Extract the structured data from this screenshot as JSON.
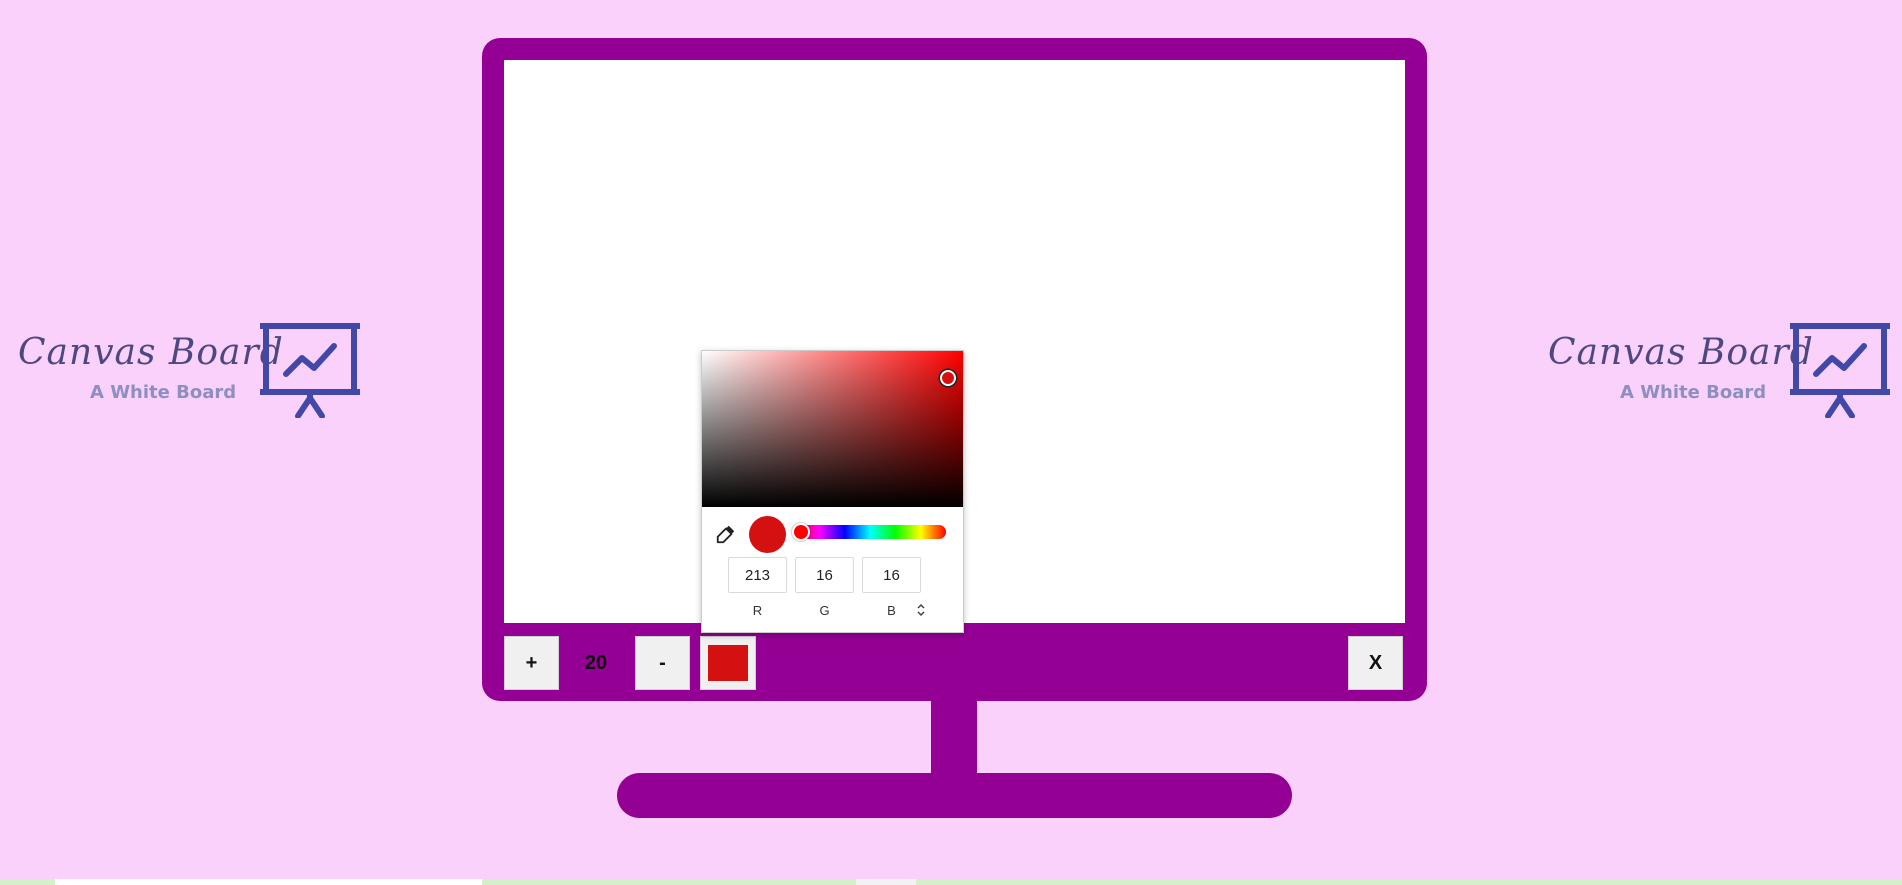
{
  "logo": {
    "title": "Canvas Board",
    "subtitle": "A White Board",
    "icon": "presentation-chart-icon",
    "title_color": "#4d4880",
    "subtitle_color": "#8d8fc0"
  },
  "colors": {
    "background": "#fad1fa",
    "monitor_frame": "#940094",
    "canvas": "#ffffff",
    "selected_color": "#d51010"
  },
  "toolbar": {
    "increase_label": "+",
    "brush_size": "20",
    "decrease_label": "-",
    "clear_label": "X"
  },
  "color_picker": {
    "r": "213",
    "g": "16",
    "b": "16",
    "r_label": "R",
    "g_label": "G",
    "b_label": "B",
    "hue": 0,
    "eyedropper_icon": "eyedropper-icon",
    "mode_toggle_icon": "chevron-up-down-icon"
  }
}
